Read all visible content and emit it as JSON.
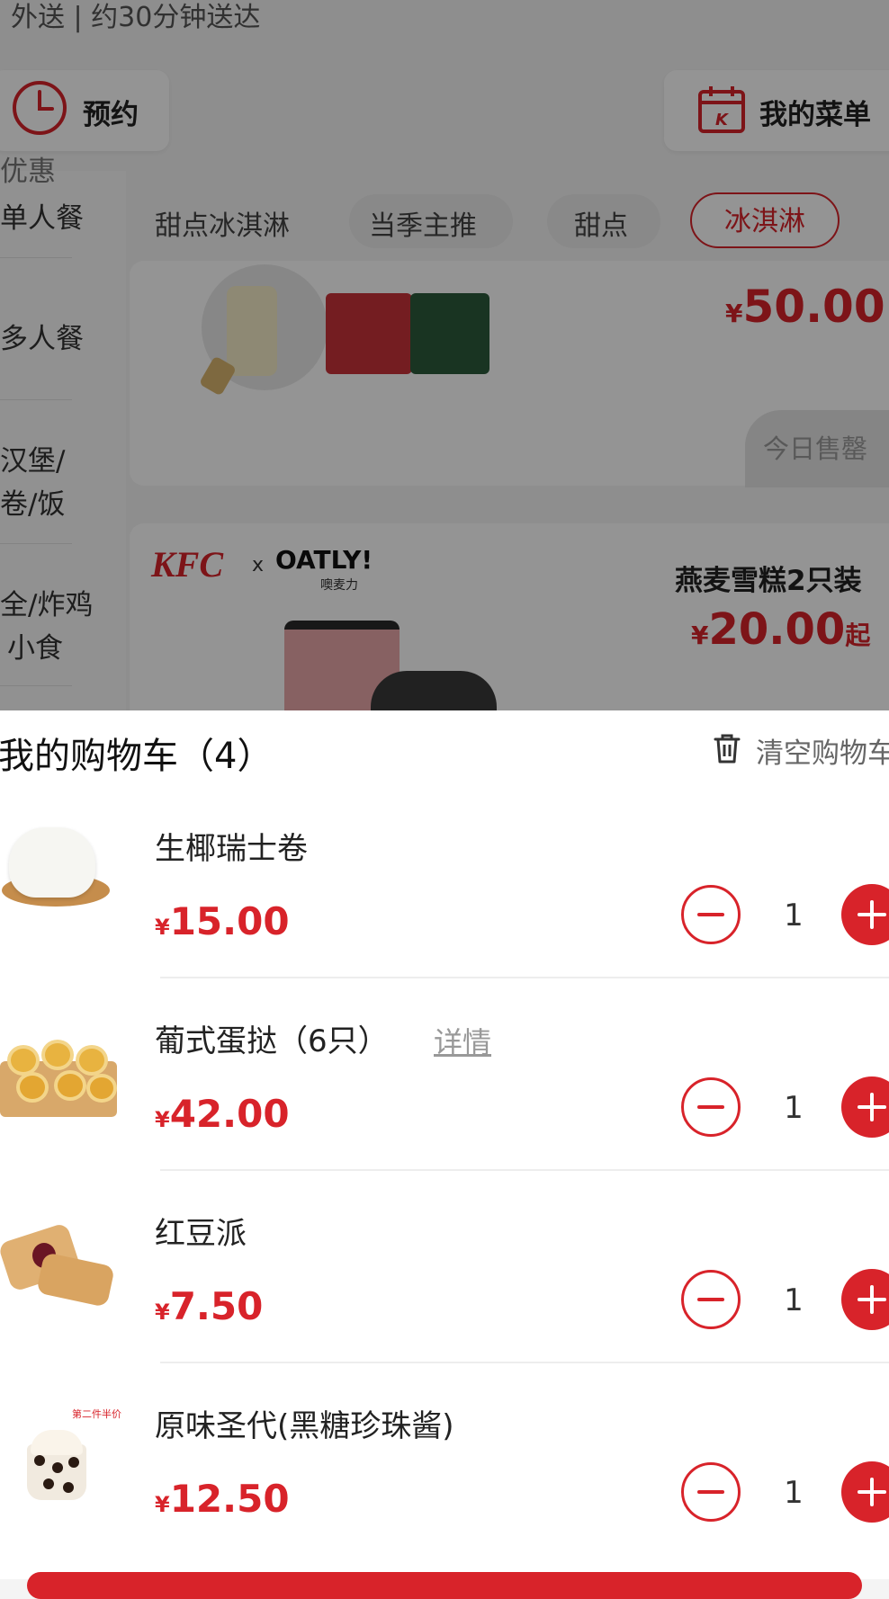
{
  "header": {
    "delivery_text": "外送 | 约30分钟送达",
    "reserve_label": "预约",
    "my_menu_label": "我的菜单"
  },
  "sidebar": {
    "items": [
      {
        "label": "优惠"
      },
      {
        "label": "单人餐"
      },
      {
        "label": "多人餐"
      },
      {
        "label": "汉堡/"
      },
      {
        "label": "卷/饭"
      },
      {
        "label": "全/炸鸡"
      },
      {
        "label": "小食"
      }
    ]
  },
  "subtabs": [
    {
      "label": "甜点冰淇淋"
    },
    {
      "label": "当季主推"
    },
    {
      "label": "甜点"
    },
    {
      "label": "冰淇淋",
      "active": true
    }
  ],
  "menu": {
    "card1": {
      "price_symbol": "¥",
      "price": "50.00",
      "status": "今日售罄"
    },
    "card2": {
      "brand": "KFC",
      "collab_x": "x",
      "collab_brand": "OATLY!",
      "collab_sub": "噢麦力",
      "name": "燕麦雪糕2只装",
      "price_symbol": "¥",
      "price": "20.00",
      "price_suffix": "起"
    }
  },
  "cart": {
    "title": "我的购物车（4）",
    "clear_label": "清空购物车",
    "items": [
      {
        "name": "生椰瑞士卷",
        "price_symbol": "¥",
        "price": "15.00",
        "qty": "1"
      },
      {
        "name": "葡式蛋挞（6只）",
        "detail": "详情",
        "price_symbol": "¥",
        "price": "42.00",
        "qty": "1"
      },
      {
        "name": "红豆派",
        "price_symbol": "¥",
        "price": "7.50",
        "qty": "1"
      },
      {
        "name": "原味圣代(黑糖珍珠酱)",
        "badge": "第二件半价",
        "price_symbol": "¥",
        "price": "12.50",
        "qty": "1"
      }
    ]
  },
  "colors": {
    "accent": "#d8232a",
    "overlay": "rgba(0,0,0,0.42)"
  }
}
